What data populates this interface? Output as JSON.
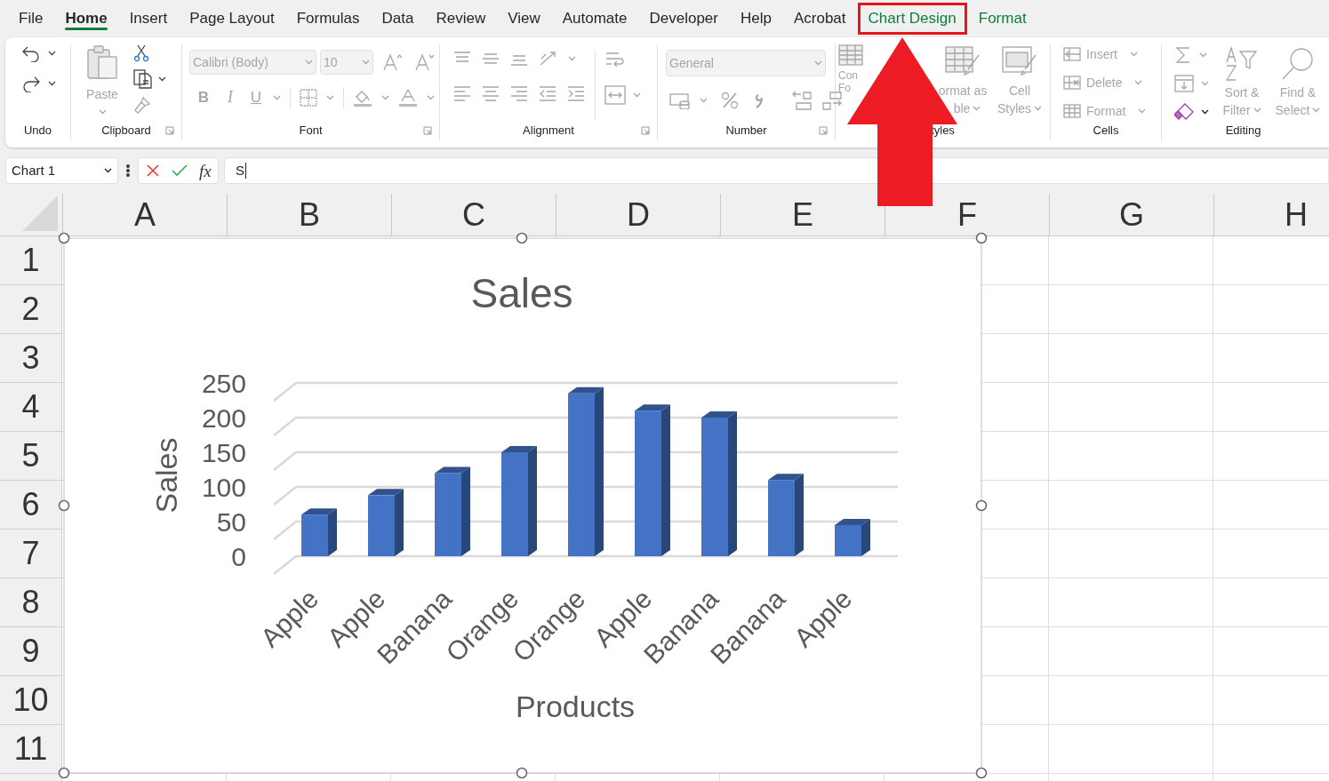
{
  "menu_tabs": [
    {
      "label": "File",
      "kind": "standard",
      "selected": false,
      "highlighted": false
    },
    {
      "label": "Home",
      "kind": "standard",
      "selected": true,
      "highlighted": false
    },
    {
      "label": "Insert",
      "kind": "standard",
      "selected": false,
      "highlighted": false
    },
    {
      "label": "Page Layout",
      "kind": "standard",
      "selected": false,
      "highlighted": false
    },
    {
      "label": "Formulas",
      "kind": "standard",
      "selected": false,
      "highlighted": false
    },
    {
      "label": "Data",
      "kind": "standard",
      "selected": false,
      "highlighted": false
    },
    {
      "label": "Review",
      "kind": "standard",
      "selected": false,
      "highlighted": false
    },
    {
      "label": "View",
      "kind": "standard",
      "selected": false,
      "highlighted": false
    },
    {
      "label": "Automate",
      "kind": "standard",
      "selected": false,
      "highlighted": false
    },
    {
      "label": "Developer",
      "kind": "standard",
      "selected": false,
      "highlighted": false
    },
    {
      "label": "Help",
      "kind": "standard",
      "selected": false,
      "highlighted": false
    },
    {
      "label": "Acrobat",
      "kind": "standard",
      "selected": false,
      "highlighted": false
    },
    {
      "label": "Chart Design",
      "kind": "contextual",
      "selected": false,
      "highlighted": true
    },
    {
      "label": "Format",
      "kind": "contextual",
      "selected": false,
      "highlighted": false
    }
  ],
  "ribbon": {
    "groups": [
      {
        "kind": "undo",
        "label": "Undo",
        "disabled": false
      },
      {
        "kind": "clipboard",
        "label": "Clipboard",
        "disabled": false,
        "paste": "Paste"
      },
      {
        "kind": "font",
        "label": "Font",
        "disabled": true,
        "font_name": "Calibri (Body)",
        "font_size": "10",
        "style_buttons": [
          "B",
          "I",
          "U"
        ]
      },
      {
        "kind": "alignment",
        "label": "Alignment",
        "disabled": true
      },
      {
        "kind": "number",
        "label": "Number",
        "disabled": true,
        "format": "General"
      },
      {
        "kind": "styles",
        "label": "tyles",
        "disabled": true,
        "buttons": [
          [
            "Con",
            "Fo"
          ],
          [
            "ormat as",
            "ble"
          ],
          [
            "Cell",
            "Styles"
          ]
        ]
      },
      {
        "kind": "cells",
        "label": "Cells",
        "disabled": true,
        "buttons": [
          "Insert",
          "Delete",
          "Format"
        ]
      },
      {
        "kind": "editing",
        "label": "Editing",
        "disabled": true,
        "buttons": [
          [
            "Sort &",
            "Filter"
          ],
          [
            "Find &",
            "Select"
          ]
        ]
      }
    ]
  },
  "formula_bar": {
    "name_box": "Chart 1",
    "function_label": "fx",
    "value": "S"
  },
  "sheet": {
    "columns": [
      "A",
      "B",
      "C",
      "D",
      "E",
      "F",
      "G",
      "H"
    ],
    "rows": [
      "1",
      "2",
      "3",
      "4",
      "5",
      "6",
      "7",
      "8",
      "9",
      "10",
      "11"
    ]
  },
  "chart": {
    "chart_data": {
      "type": "bar",
      "title": "Sales",
      "xlabel": "Products",
      "ylabel": "Sales",
      "categories": [
        "Apple",
        "Apple",
        "Banana",
        "Orange",
        "Orange",
        "Apple",
        "Banana",
        "Banana",
        "Apple"
      ],
      "series": [
        {
          "color": "#4472c4",
          "values": [
            60,
            88,
            120,
            150,
            235,
            210,
            200,
            110,
            45
          ]
        }
      ],
      "ylim": [
        0,
        250
      ],
      "yticks": [
        0,
        50,
        100,
        150,
        200,
        250
      ]
    }
  },
  "annotations": [
    {
      "kind": "arrow"
    }
  ]
}
